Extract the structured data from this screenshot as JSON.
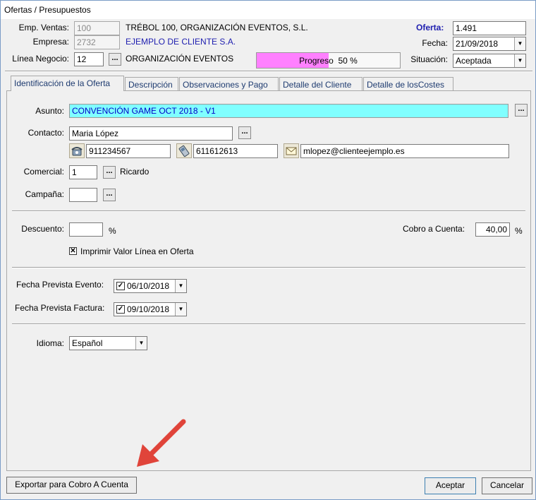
{
  "window": {
    "title": "Ofertas / Presupuestos"
  },
  "header": {
    "emp_ventas_label": "Emp. Ventas:",
    "emp_ventas_value": "100",
    "emp_ventas_name": "TRÉBOL 100, ORGANIZACIÓN EVENTOS, S.L.",
    "empresa_label": "Empresa:",
    "empresa_value": "2732",
    "empresa_name": "EJEMPLO DE CLIENTE S.A.",
    "linea_label": "Línea Negocio:",
    "linea_value": "12",
    "linea_name": "ORGANIZACIÓN EVENTOS",
    "progreso_label": "Progreso",
    "progreso_value": "50 %",
    "progreso_fraction": 0.5,
    "oferta_label": "Oferta:",
    "oferta_value": "1.491",
    "fecha_label": "Fecha:",
    "fecha_value": "21/09/2018",
    "situacion_label": "Situación:",
    "situacion_value": "Aceptada"
  },
  "tabs": [
    {
      "label": "Identificación de la Oferta"
    },
    {
      "label": "Descripción"
    },
    {
      "label": "Observaciones y Pago"
    },
    {
      "label": "Detalle del Cliente"
    },
    {
      "label": "Detalle de losCostes"
    }
  ],
  "form": {
    "asunto_label": "Asunto:",
    "asunto_value": "CONVENCIÓN GAME OCT 2018 - V1",
    "contacto_label": "Contacto:",
    "contacto_value": "Maria López",
    "phone_value": "911234567",
    "mobile_value": "611612613",
    "email_value": "mlopez@clienteejemplo.es",
    "comercial_label": "Comercial:",
    "comercial_value": "1",
    "comercial_name": "Ricardo",
    "campana_label": "Campaña:",
    "campana_value": "",
    "descuento_label": "Descuento:",
    "descuento_value": "",
    "percent": "%",
    "cobro_label": "Cobro a Cuenta:",
    "cobro_value": "40,00",
    "imprimir_label": "Imprimir Valor Línea en Oferta",
    "imprimir_checked": true,
    "fecha_evento_label": "Fecha Prevista Evento:",
    "fecha_evento_value": "06/10/2018",
    "fecha_factura_label": "Fecha Prevista Factura:",
    "fecha_factura_value": "09/10/2018",
    "idioma_label": "Idioma:",
    "idioma_value": "Español",
    "dots": "..."
  },
  "footer": {
    "exportar_label": "Exportar para Cobro A Cuenta",
    "aceptar_label": "Aceptar",
    "cancelar_label": "Cancelar"
  },
  "colors": {
    "progress_fill": "#ff80ff",
    "asunto_bg": "#80ffff",
    "asunto_text": "#0000c8",
    "link_blue": "#2020b0",
    "arrow_red": "#e0443a"
  },
  "icons": [
    "phone-icon",
    "mobile-phone-icon",
    "envelope-icon",
    "chevron-down-icon",
    "arrow-annotation-icon"
  ]
}
